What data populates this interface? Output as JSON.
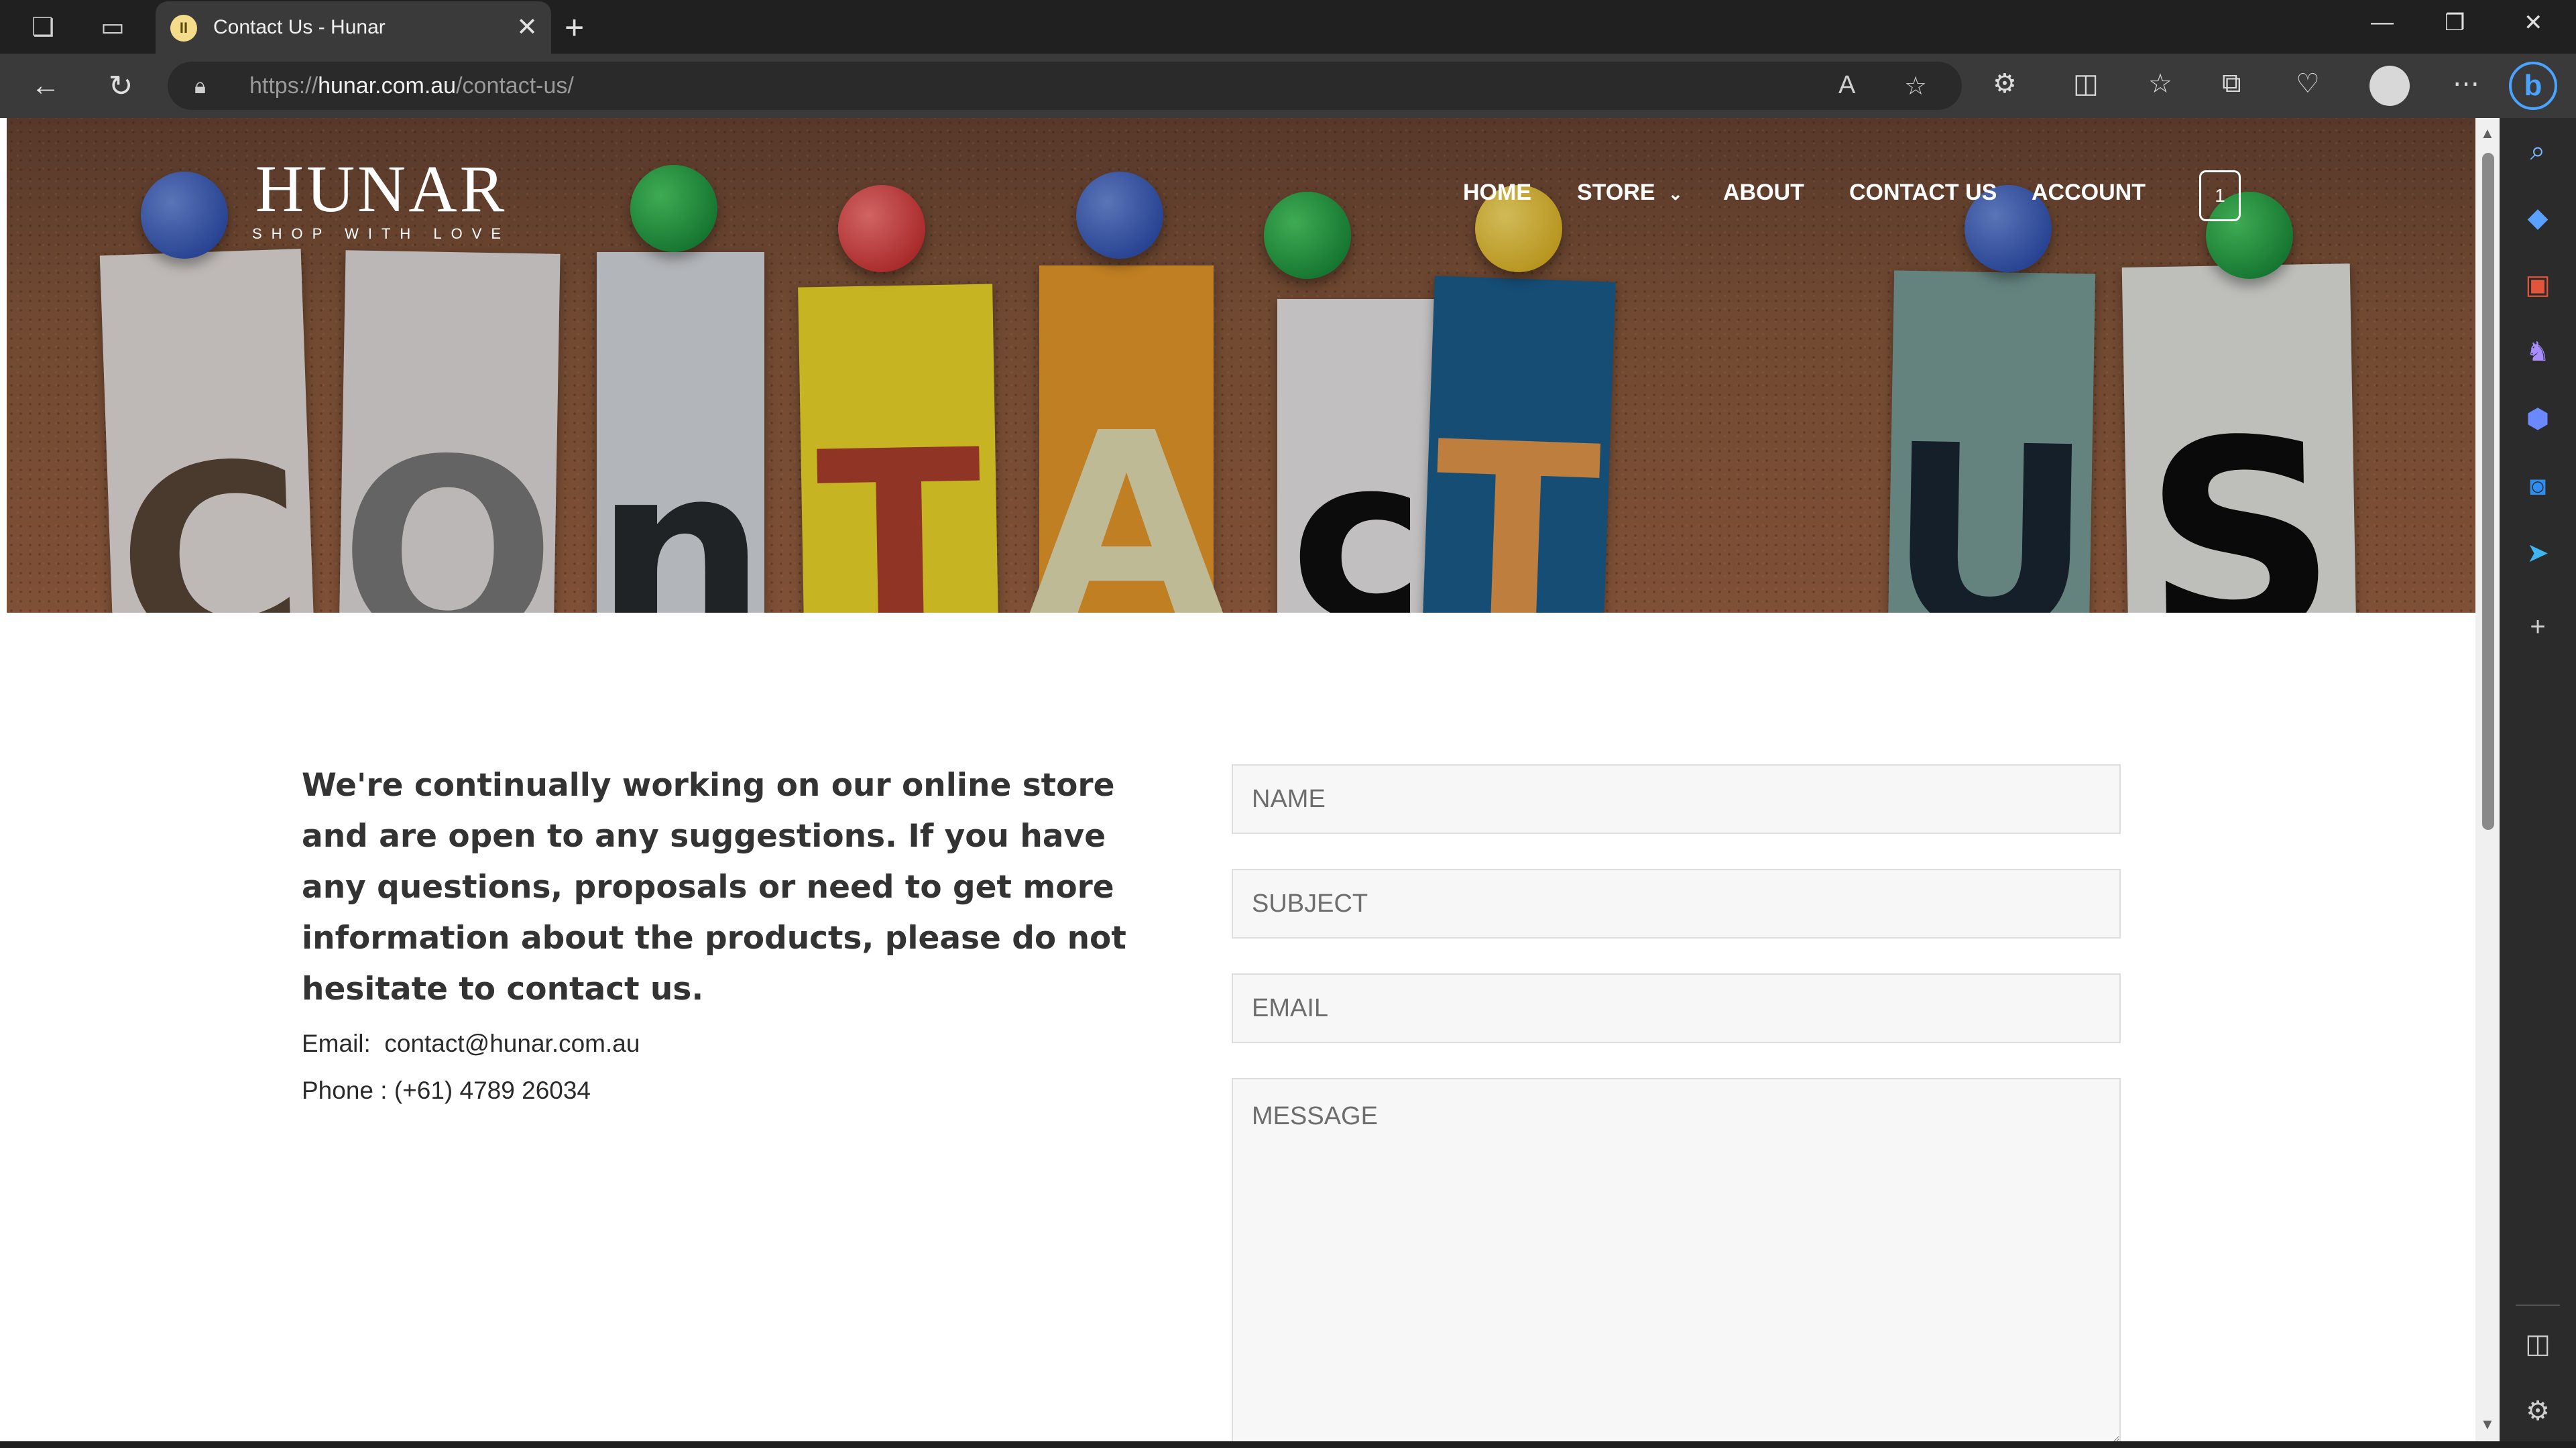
{
  "browser": {
    "tab_title": "Contact Us - Hunar",
    "tab_favicon_glyph": "II",
    "url_scheme": "https://",
    "url_host": "hunar.com.au",
    "url_path": "/contact-us/"
  },
  "site": {
    "logo_name": "HUNAR",
    "logo_tagline": "SHOP WITH LOVE",
    "nav": {
      "home": "HOME",
      "store": "STORE",
      "about": "ABOUT",
      "contact": "CONTACT US",
      "account": "ACCOUNT"
    },
    "cart_count": "1"
  },
  "hero": {
    "letters": [
      "C",
      "O",
      "n",
      "T",
      "A",
      "c",
      "T",
      "U",
      "S"
    ]
  },
  "content": {
    "intro": "We're continually working on our online store and are open to any suggestions. If you have any questions, proposals or need to get more information about the products, please do not hesitate to contact us.",
    "email_label": "Email:",
    "email_value": "contact@hunar.com.au",
    "phone_label": "Phone :",
    "phone_value": "(+61) 4789 26034"
  },
  "form": {
    "name_placeholder": "NAME",
    "subject_placeholder": "SUBJECT",
    "email_placeholder": "EMAIL",
    "message_placeholder": "MESSAGE"
  },
  "colors": {
    "browser_frame": "#202020",
    "accent_blue": "#4aa3ff",
    "text_dark": "#333333",
    "field_bg": "#f7f7f7"
  },
  "icons": {
    "sidebar": [
      "search-icon",
      "tag-icon",
      "briefcase-icon",
      "chess-icon",
      "copilot-icon",
      "outlook-icon",
      "send-icon",
      "add-icon",
      "sidebar-panel-icon",
      "settings-icon"
    ]
  }
}
